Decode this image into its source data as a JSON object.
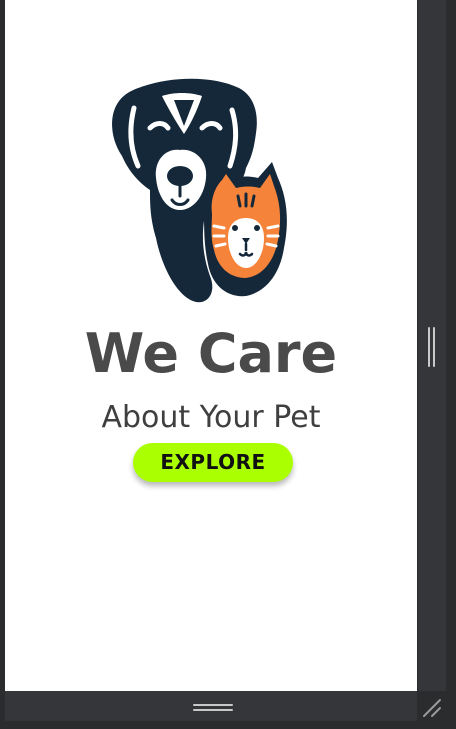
{
  "hero": {
    "headline": "We Care",
    "subheadline": "About Your Pet",
    "cta_label": "EXPLORE",
    "logo_icon": "dog-and-cat-logo-icon"
  },
  "colors": {
    "accent": "#aaff00",
    "text_dark": "#4a4a4a",
    "logo_dark": "#14283a",
    "logo_orange": "#f5843a",
    "frame": "#2b2c2e",
    "rail": "#35363a"
  },
  "chrome": {
    "right_handle_icon": "drag-handle-vertical-icon",
    "bottom_handle_icon": "drag-handle-horizontal-icon",
    "corner_icon": "resize-corner-icon"
  }
}
